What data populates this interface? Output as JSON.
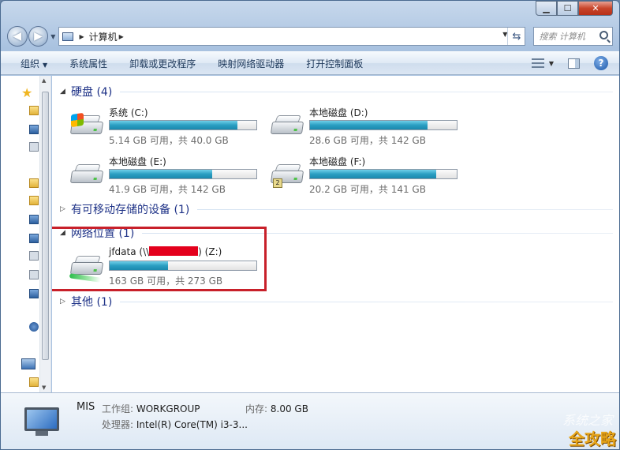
{
  "address": {
    "segments": [
      "计算机"
    ]
  },
  "search": {
    "placeholder": "搜索 计算机"
  },
  "toolbar": {
    "items": [
      {
        "label": "组织",
        "dropdown": true
      },
      {
        "label": "系统属性"
      },
      {
        "label": "卸载或更改程序"
      },
      {
        "label": "映射网络驱动器"
      },
      {
        "label": "打开控制面板"
      }
    ]
  },
  "groups": {
    "hard_disks": {
      "title": "硬盘 (4)",
      "expanded": true
    },
    "removable": {
      "title": "有可移动存储的设备 (1)",
      "expanded": false
    },
    "network": {
      "title": "网络位置 (1)",
      "expanded": true
    },
    "other": {
      "title": "其他 (1)",
      "expanded": false
    }
  },
  "drives": [
    {
      "name": "系统 (C:)",
      "info": "5.14 GB 可用，共 40.0 GB",
      "used_fraction": 0.87,
      "icon": "windows-drive-icon"
    },
    {
      "name": "本地磁盘 (D:)",
      "info": "28.6 GB 可用，共 142 GB",
      "used_fraction": 0.8,
      "icon": "hard-drive-icon"
    },
    {
      "name": "本地磁盘 (E:)",
      "info": "41.9 GB 可用，共 142 GB",
      "used_fraction": 0.7,
      "icon": "hard-drive-icon"
    },
    {
      "name": "本地磁盘 (F:)",
      "info": "20.2 GB 可用，共 141 GB",
      "used_fraction": 0.86,
      "icon": "hard-drive-icon"
    }
  ],
  "network_drive": {
    "name_prefix": "jfdata (\\\\",
    "name_suffix": ") (Z:)",
    "info": "163 GB 可用，共 273 GB",
    "used_fraction": 0.4,
    "icon": "network-drive-icon"
  },
  "details": {
    "computer_name": "MIS",
    "workgroup_label": "工作组:",
    "workgroup_value": "WORKGROUP",
    "memory_label": "内存:",
    "memory_value": "8.00 GB",
    "processor_label": "处理器:",
    "processor_value": "Intel(R) Core(TM) i3-3..."
  },
  "watermark": {
    "text": "全攻略",
    "back_text": "系统之家"
  },
  "colors": {
    "highlight": "#c8202a",
    "bar_fill": "#26a0c4",
    "redaction": "#e4001c"
  }
}
